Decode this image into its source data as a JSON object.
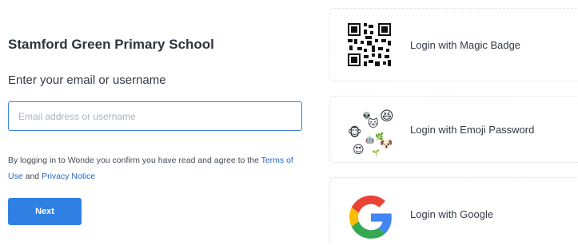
{
  "login": {
    "school_name": "Stamford Green Primary School",
    "prompt": "Enter your email or username",
    "email_placeholder": "Email address or username",
    "agreement_prefix": "By logging in to Wonde you confirm you have read and agree to the",
    "terms_link": "Terms of Use",
    "agreement_and": "and",
    "privacy_link": "Privacy Notice",
    "next_label": "Next"
  },
  "options": [
    {
      "label": "Login with Magic Badge",
      "icon": "qr-code-icon"
    },
    {
      "label": "Login with Emoji Password",
      "icon": "emoji-cluster-icon"
    },
    {
      "label": "Login with Google",
      "icon": "google-g-icon"
    }
  ],
  "colors": {
    "primary": "#2f80e2",
    "link": "#2866c5",
    "input_border": "#3b82e0",
    "google_blue": "#4285f4",
    "google_red": "#ea4335",
    "google_yellow": "#fbbc05",
    "google_green": "#34a853"
  }
}
